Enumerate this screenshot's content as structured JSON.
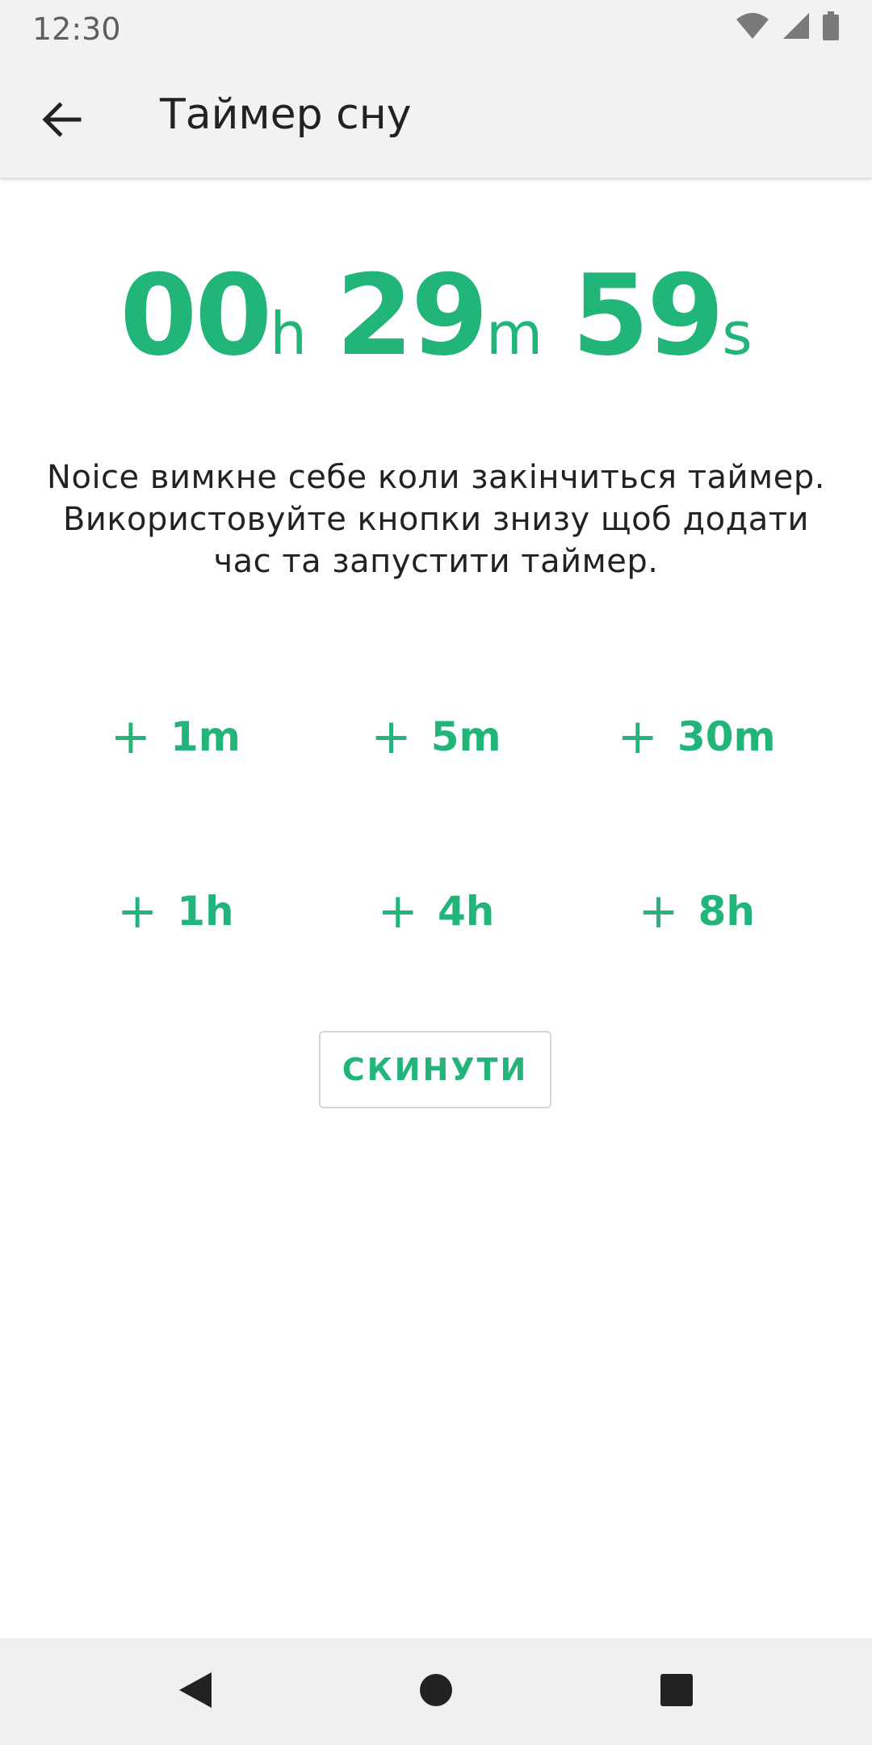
{
  "status_bar": {
    "time": "12:30",
    "icons": [
      "wifi-icon",
      "signal-icon",
      "battery-icon"
    ]
  },
  "app_bar": {
    "back_icon": "arrow-back-icon",
    "title": "Таймер сну"
  },
  "timer": {
    "hours": "00",
    "hours_unit": "h",
    "minutes": "29",
    "minutes_unit": "m",
    "seconds": "59",
    "seconds_unit": "s"
  },
  "description": {
    "line1": "Noice вимкне себе коли закінчиться таймер.",
    "line2": "Використовуйте кнопки знизу щоб додати",
    "line3": "час та запустити таймер."
  },
  "add_buttons": [
    {
      "plus": "+",
      "label": "1m"
    },
    {
      "plus": "+",
      "label": "5m"
    },
    {
      "plus": "+",
      "label": "30m"
    },
    {
      "plus": "+",
      "label": "1h"
    },
    {
      "plus": "+",
      "label": "4h"
    },
    {
      "plus": "+",
      "label": "8h"
    }
  ],
  "reset_button": {
    "label": "СКИНУТИ"
  },
  "nav_bar": {
    "icons": [
      "nav-back-icon",
      "nav-home-icon",
      "nav-recents-icon"
    ]
  },
  "colors": {
    "accent": "#22b57a",
    "bar_background": "#f2f2f2",
    "text_primary": "#222222"
  }
}
